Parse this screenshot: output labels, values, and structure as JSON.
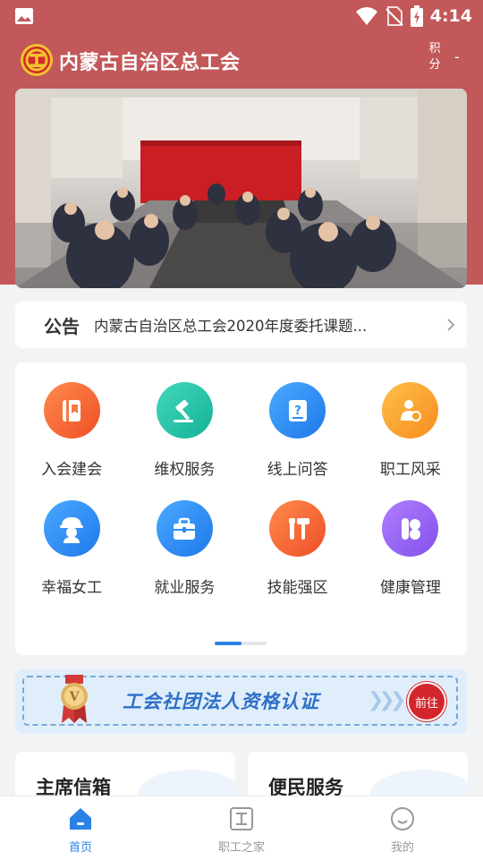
{
  "status_bar": {
    "time": "4:14"
  },
  "header": {
    "title": "内蒙古自治区总工会",
    "points_label": "积分",
    "points_value": "-"
  },
  "notice": {
    "tag": "公告",
    "text": "内蒙古自治区总工会2020年度委托课题..."
  },
  "services": [
    {
      "label": "入会建会",
      "icon": "bookmark-book-icon",
      "color": "#f05a2b"
    },
    {
      "label": "维权服务",
      "icon": "gavel-icon",
      "color": "#1fbfa6"
    },
    {
      "label": "线上问答",
      "icon": "question-card-icon",
      "color": "#2b8ef0"
    },
    {
      "label": "职工风采",
      "icon": "worker-flower-icon",
      "color": "#f7a12a"
    },
    {
      "label": "幸福女工",
      "icon": "female-worker-icon",
      "color": "#2b8ef0"
    },
    {
      "label": "就业服务",
      "icon": "briefcase-icon",
      "color": "#2b8ef0"
    },
    {
      "label": "技能强区",
      "icon": "tools-icon",
      "color": "#f05a2b"
    },
    {
      "label": "健康管理",
      "icon": "health-k-icon",
      "color": "#8d5cf0"
    }
  ],
  "pager": {
    "pages": 2,
    "current": 1
  },
  "cert_banner": {
    "text": "工会社团法人资格认证",
    "button": "前往",
    "medal_letter": "V"
  },
  "cards": {
    "left": "主席信箱",
    "right": "便民服务"
  },
  "tabbar": [
    {
      "label": "首页",
      "icon": "home-icon",
      "active": true
    },
    {
      "label": "职工之家",
      "icon": "workers-home-icon",
      "active": false
    },
    {
      "label": "我的",
      "icon": "smile-icon",
      "active": false
    }
  ],
  "colors": {
    "brand": "#c25859",
    "accent": "#2a82e4",
    "cert_text": "#2f6fc7"
  }
}
